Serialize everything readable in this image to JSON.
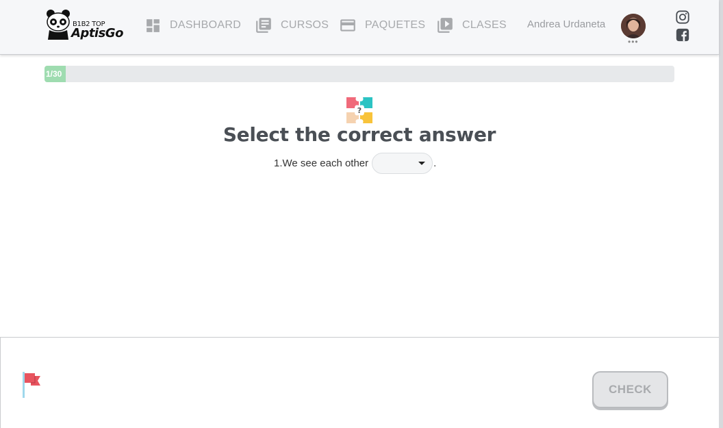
{
  "header": {
    "logo": {
      "tagline": "B1B2 TOP",
      "brand": "AptisGo"
    },
    "nav": [
      {
        "label": "DASHBOARD",
        "icon": "dashboard-icon"
      },
      {
        "label": "CURSOS",
        "icon": "book-icon"
      },
      {
        "label": "PAQUETES",
        "icon": "card-icon"
      },
      {
        "label": "CLASES",
        "icon": "video-library-icon"
      }
    ],
    "user": {
      "name": "Andrea Urdaneta",
      "menu_dots": "•••"
    },
    "social": [
      "instagram-icon",
      "facebook-icon"
    ]
  },
  "progress": {
    "label": "1/30",
    "current": 1,
    "total": 30
  },
  "question": {
    "title": "Select the correct answer",
    "prompt": "1.We see each other",
    "selected_value": "",
    "end_punctuation": "."
  },
  "footer": {
    "check_label": "CHECK",
    "flag_icon": "report-flag-icon"
  },
  "colors": {
    "nav_text": "#a7a9ac",
    "progress_fill": "#9fdcb0",
    "title": "#4a4f55",
    "check_bg": "#e4e5e7"
  }
}
